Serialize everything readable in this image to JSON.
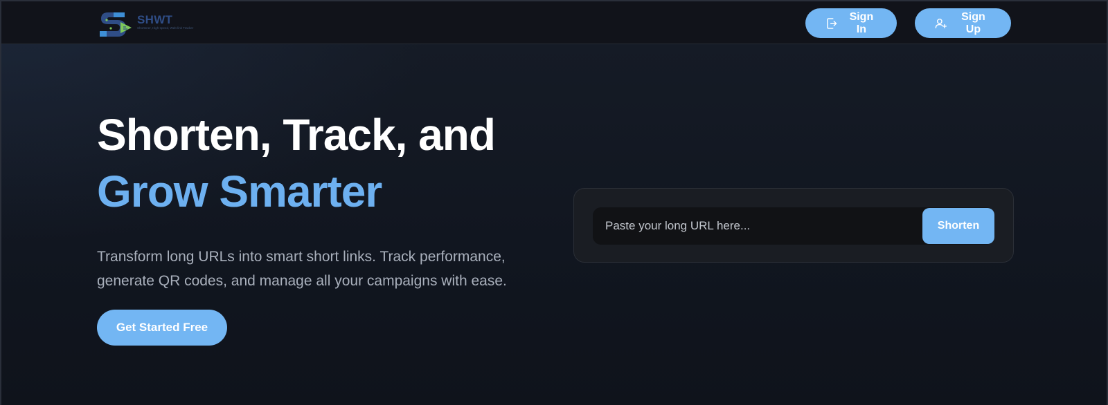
{
  "brand": {
    "name": "SHWT",
    "tagline": "Shortener, High-speed, Web-link Tracker",
    "colors": {
      "accent": "#73b6f3",
      "highlight": "#6db0f0",
      "logo_navy": "#2f4d86",
      "logo_green": "#7ec85a",
      "logo_blue": "#3e8fd6"
    }
  },
  "nav": {
    "signin_label": "Sign In",
    "signin_icon": "sign-in-icon",
    "signup_label": "Sign Up",
    "signup_icon": "user-plus-icon"
  },
  "hero": {
    "headline_line1": "Shorten, Track, and",
    "headline_line2": "Grow Smarter",
    "subtext": "Transform long URLs into smart short links. Track performance, generate QR codes, and manage all your campaigns with ease.",
    "cta_label": "Get Started Free"
  },
  "shortener": {
    "input_value": "",
    "input_placeholder": "Paste your long URL here...",
    "button_label": "Shorten"
  }
}
